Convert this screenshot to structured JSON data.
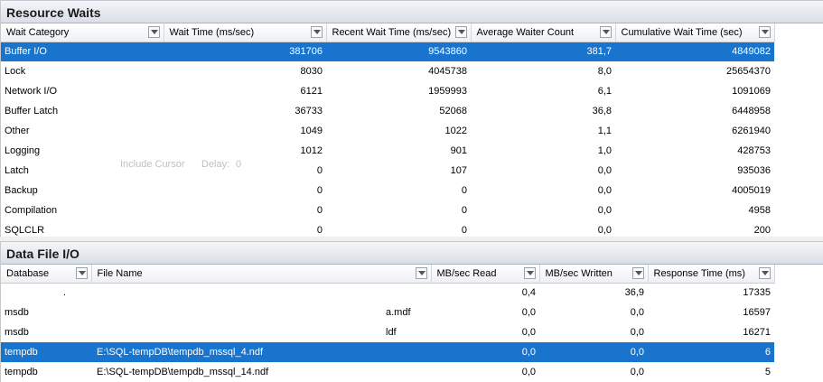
{
  "resource_waits": {
    "title": "Resource Waits",
    "columns": [
      "Wait Category",
      "Wait Time (ms/sec)",
      "Recent Wait Time (ms/sec)",
      "Average Waiter Count",
      "Cumulative Wait Time (sec)"
    ],
    "rows": [
      [
        "Buffer I/O",
        "381706",
        "9543860",
        "381,7",
        "4849082"
      ],
      [
        "Lock",
        "8030",
        "4045738",
        "8,0",
        "25654370"
      ],
      [
        "Network I/O",
        "6121",
        "1959993",
        "6,1",
        "1091069"
      ],
      [
        "Buffer Latch",
        "36733",
        "52068",
        "36,8",
        "6448958"
      ],
      [
        "Other",
        "1049",
        "1022",
        "1,1",
        "6261940"
      ],
      [
        "Logging",
        "1012",
        "901",
        "1,0",
        "428753"
      ],
      [
        "Latch",
        "0",
        "107",
        "0,0",
        "935036"
      ],
      [
        "Backup",
        "0",
        "0",
        "0,0",
        "4005019"
      ],
      [
        "Compilation",
        "0",
        "0",
        "0,0",
        "4958"
      ],
      [
        "SQLCLR",
        "0",
        "0",
        "0,0",
        "200"
      ]
    ],
    "selected_row": 0
  },
  "background_options": {
    "include_cursor": "Include Cursor",
    "delay_label": "Delay:",
    "delay_value": "0"
  },
  "data_file_io": {
    "title": "Data File I/O",
    "columns": [
      "Database",
      "File Name",
      "MB/sec Read",
      "MB/sec Written",
      "Response Time (ms)"
    ],
    "rows": [
      [
        ".",
        "",
        "0,4",
        "36,9",
        "17335"
      ],
      [
        "msdb",
        "a.mdf",
        "0,0",
        "0,0",
        "16597"
      ],
      [
        "msdb",
        "ldf",
        "0,0",
        "0,0",
        "16271"
      ],
      [
        "tempdb",
        "E:\\SQL-tempDB\\tempdb_mssql_4.ndf",
        "0,0",
        "0,0",
        "6"
      ],
      [
        "tempdb",
        "E:\\SQL-tempDB\\tempdb_mssql_14.ndf",
        "0,0",
        "0,0",
        "5"
      ]
    ],
    "selected_row": 3
  },
  "colors": {
    "selection": "#1874cd",
    "header_gradient_top": "#f4f6f9",
    "header_gradient_bottom": "#d9dee6"
  }
}
